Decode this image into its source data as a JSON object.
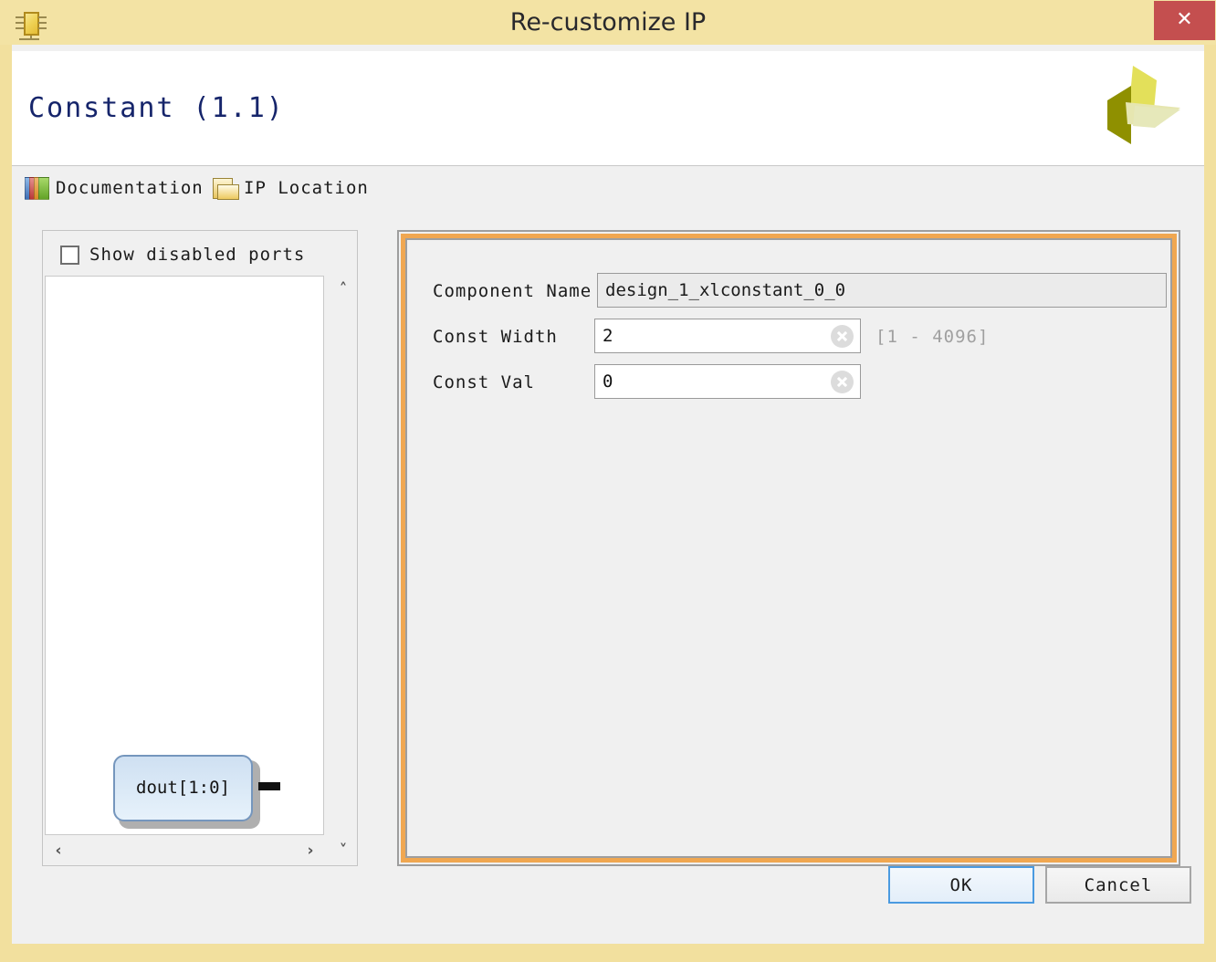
{
  "window": {
    "title": "Re-customize IP",
    "icon": "ip-chip-icon",
    "close_label": "✕",
    "frame_color": "#f2e09e"
  },
  "header": {
    "ip_title": "Constant (1.1)",
    "logo": "xilinx-logo",
    "title_color": "#16256b"
  },
  "toolbar": {
    "items": [
      {
        "label": "Documentation",
        "icon": "books-icon"
      },
      {
        "label": "IP Location",
        "icon": "folder-icon"
      }
    ]
  },
  "left_panel": {
    "show_disabled_ports": {
      "label": "Show disabled ports",
      "checked": false
    },
    "symbol": {
      "port_label": "dout[1:0]",
      "block_fill": "#d9e8f6",
      "block_border": "#7596bd"
    },
    "scrollbars": {
      "up": "˄",
      "down": "˅",
      "left": "‹",
      "right": "›"
    }
  },
  "form": {
    "accent_color": "#f0a751",
    "fields": [
      {
        "label": "Component Name",
        "value": "design_1_xlconstant_0_0",
        "readonly": true,
        "hint": ""
      },
      {
        "label": "Const Width",
        "value": "2",
        "readonly": false,
        "hint": "[1 - 4096]"
      },
      {
        "label": "Const Val",
        "value": "0",
        "readonly": false,
        "hint": ""
      }
    ]
  },
  "footer": {
    "ok_label": "OK",
    "cancel_label": "Cancel"
  }
}
